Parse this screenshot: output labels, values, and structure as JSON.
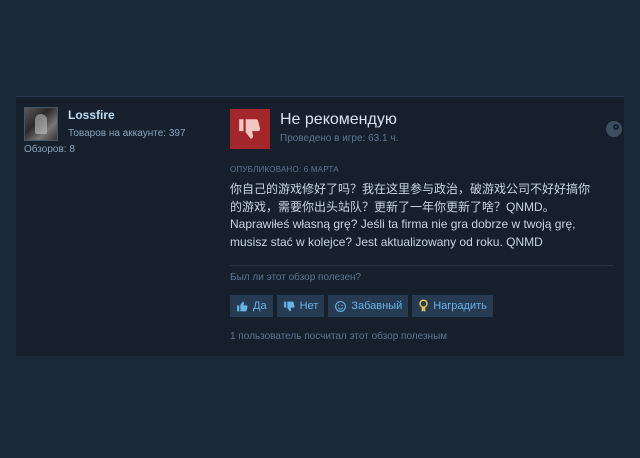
{
  "author": {
    "name": "Lossfire",
    "products": "Товаров на аккаунте: 397",
    "reviews": "Обзоров: 8"
  },
  "review": {
    "verdict": "Не рекомендую",
    "hours": "Проведено в игре: 63.1 ч.",
    "posted": "ОПУБЛИКОВАНО: 6 МАРТА",
    "text": "你自己的游戏修好了吗？我在这里参与政治，破游戏公司不好好搞你\n的游戏，需要你出头站队？更新了一年你更新了啥？QNMD。\nNaprawiłeś własną grę? Jeśli ta firma nie gra dobrze w twoją grę,\nmusisz stać w kolejce? Jest aktualizowany od roku. QNMD"
  },
  "feedback": {
    "question": "Был ли этот обзор полезен?",
    "yes": "Да",
    "no": "Нет",
    "funny": "Забавный",
    "award": "Наградить",
    "count_text": "1 пользователь посчитал этот обзор полезным"
  },
  "colors": {
    "background": "#1b2838",
    "panel": "#16202d",
    "not_recommended": "#a3262a",
    "button_bg": "#263a52",
    "button_text": "#66b5e8"
  },
  "icons": [
    "thumbs-down-icon",
    "steam-icon",
    "thumbs-up-icon",
    "smiley-icon",
    "award-icon"
  ]
}
